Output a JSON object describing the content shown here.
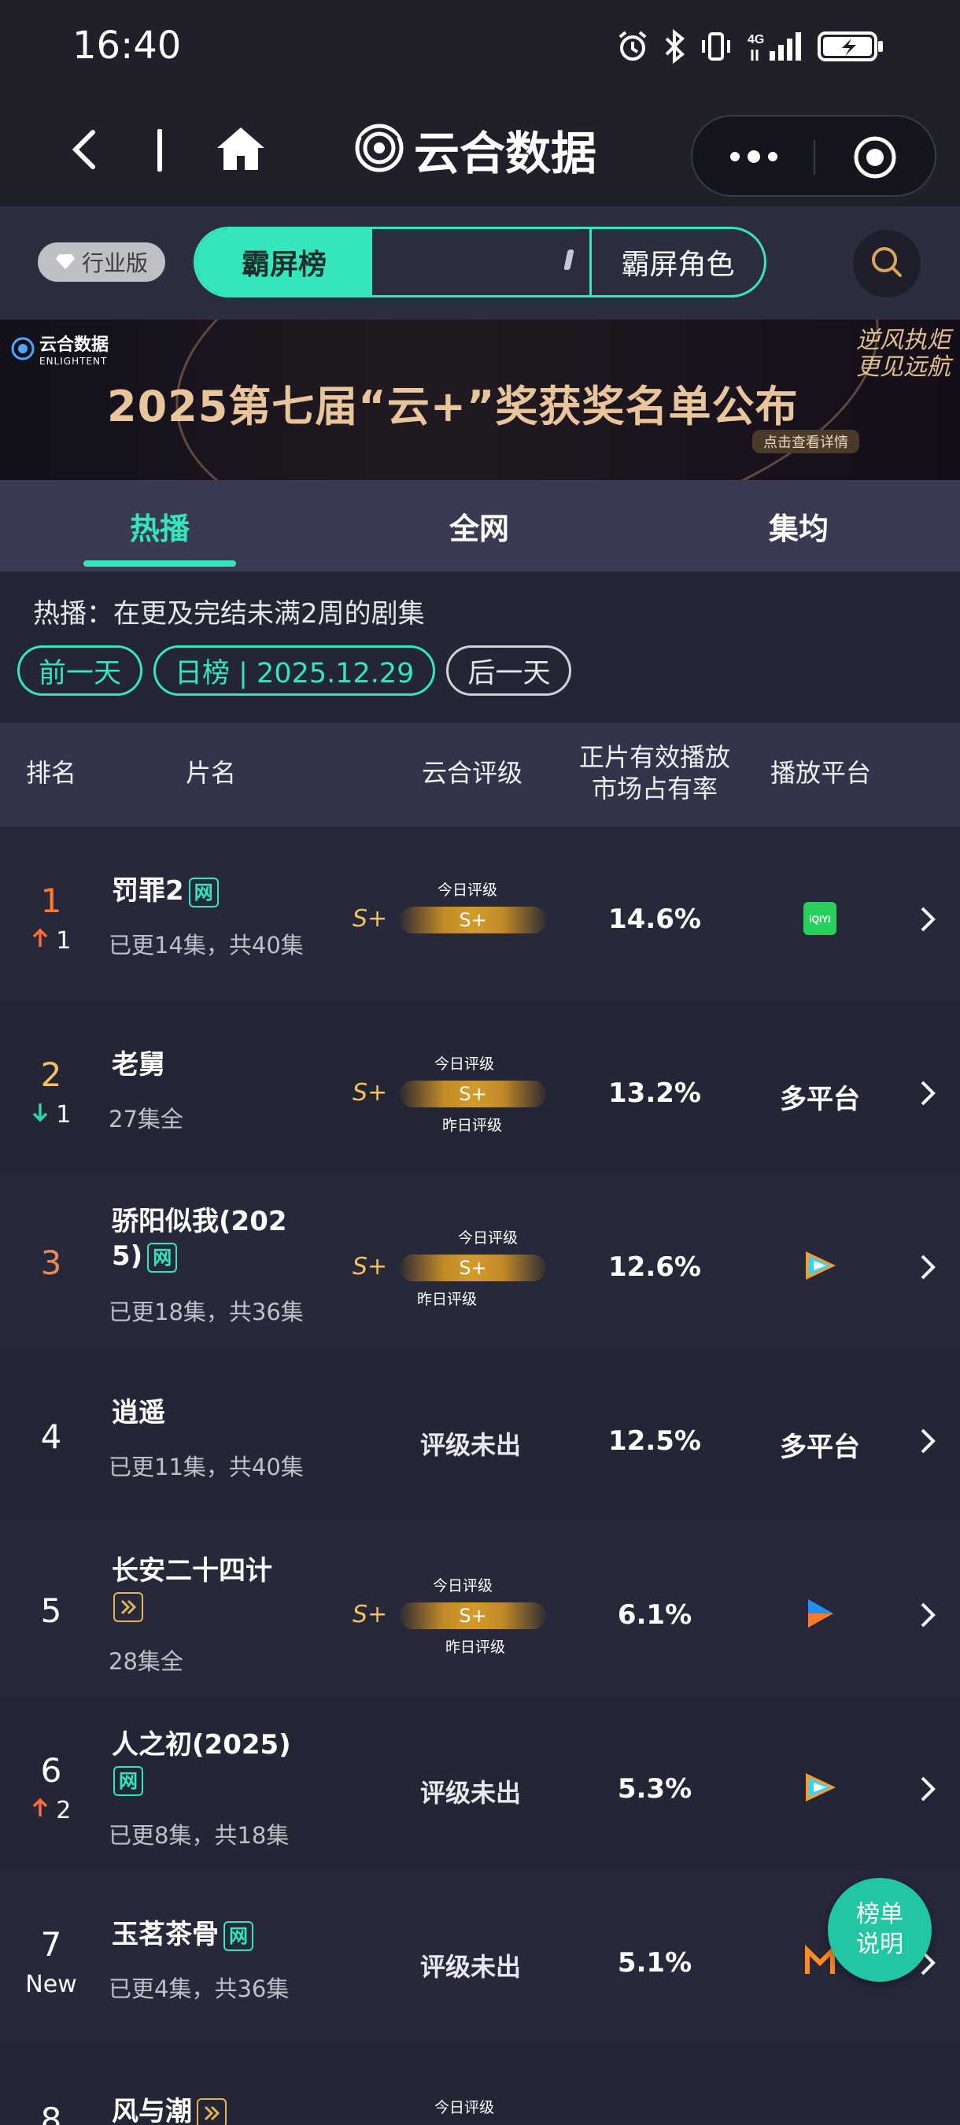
{
  "status_bar": {
    "time": "16:40",
    "network": "4G"
  },
  "nav": {
    "app_name": "云合数据"
  },
  "toolbar": {
    "industry_label": "行业版",
    "segment_active": "霸屏榜",
    "segment_right": "霸屏角色"
  },
  "banner": {
    "logo_text": "云合数据",
    "logo_sub": "ENLIGHTENT",
    "title": "2025第七届“云+”奖获奖名单公布",
    "slogan_line1": "逆风执炬",
    "slogan_line2": "更见远航",
    "cta": "点击查看详情"
  },
  "tabs": [
    {
      "label": "热播",
      "active": true
    },
    {
      "label": "全网",
      "active": false
    },
    {
      "label": "集均",
      "active": false
    }
  ],
  "description": "热播：在更及完结未满2周的剧集",
  "date_nav": {
    "prev": "前一天",
    "current": "日榜 | 2025.12.29",
    "next": "后一天"
  },
  "table": {
    "headers": {
      "rank": "排名",
      "title": "片名",
      "rating": "云合评级",
      "share_line1": "正片有效播放",
      "share_line2": "市场占有率",
      "platform": "播放平台"
    },
    "rating_today_label": "今日评级",
    "rating_yesterday_label": "昨日评级",
    "rating_pending": "评级未出",
    "rows": [
      {
        "rank": "1",
        "change": "1",
        "change_dir": "up",
        "title": "罚罪2",
        "badge": "网",
        "sub": "已更14集，共40集",
        "rating": "S+",
        "bar_value": "S+",
        "share": "14.6%",
        "platform": "iqiyi"
      },
      {
        "rank": "2",
        "change": "1",
        "change_dir": "down",
        "title": "老舅",
        "sub": "27集全",
        "rating": "S+",
        "bar_value": "S+",
        "share": "13.2%",
        "platform_text": "多平台"
      },
      {
        "rank": "3",
        "title_line1": "骄阳似我(202",
        "title_line2": "5)",
        "badge": "网",
        "sub": "已更18集，共36集",
        "rating": "S+",
        "bar_value": "S+",
        "share": "12.6%",
        "platform": "tencent"
      },
      {
        "rank": "4",
        "title": "逍遥",
        "sub": "已更11集，共40集",
        "share": "12.5%",
        "platform_text": "多平台"
      },
      {
        "rank": "5",
        "title": "长安二十四计",
        "badge": "play",
        "sub": "28集全",
        "rating": "S+",
        "bar_value": "S+",
        "share": "6.1%",
        "platform": "youku"
      },
      {
        "rank": "6",
        "change": "2",
        "change_dir": "up",
        "title": "人之初(2025)",
        "badge": "网",
        "sub": "已更8集，共18集",
        "share": "5.3%",
        "platform": "tencent"
      },
      {
        "rank": "7",
        "change": "New",
        "title": "玉茗茶骨",
        "badge": "网",
        "sub": "已更4集，共36集",
        "share": "5.1%",
        "platform": "mgtv"
      },
      {
        "rank": "8",
        "title": "风与潮",
        "badge": "play"
      }
    ]
  },
  "float_button": {
    "line1": "榜单",
    "line2": "说明"
  },
  "colors": {
    "accent": "#35e6bc",
    "gold": "#f2c161",
    "up": "#ff6a3d",
    "down": "#2fd6a6",
    "bg": "#252635"
  }
}
